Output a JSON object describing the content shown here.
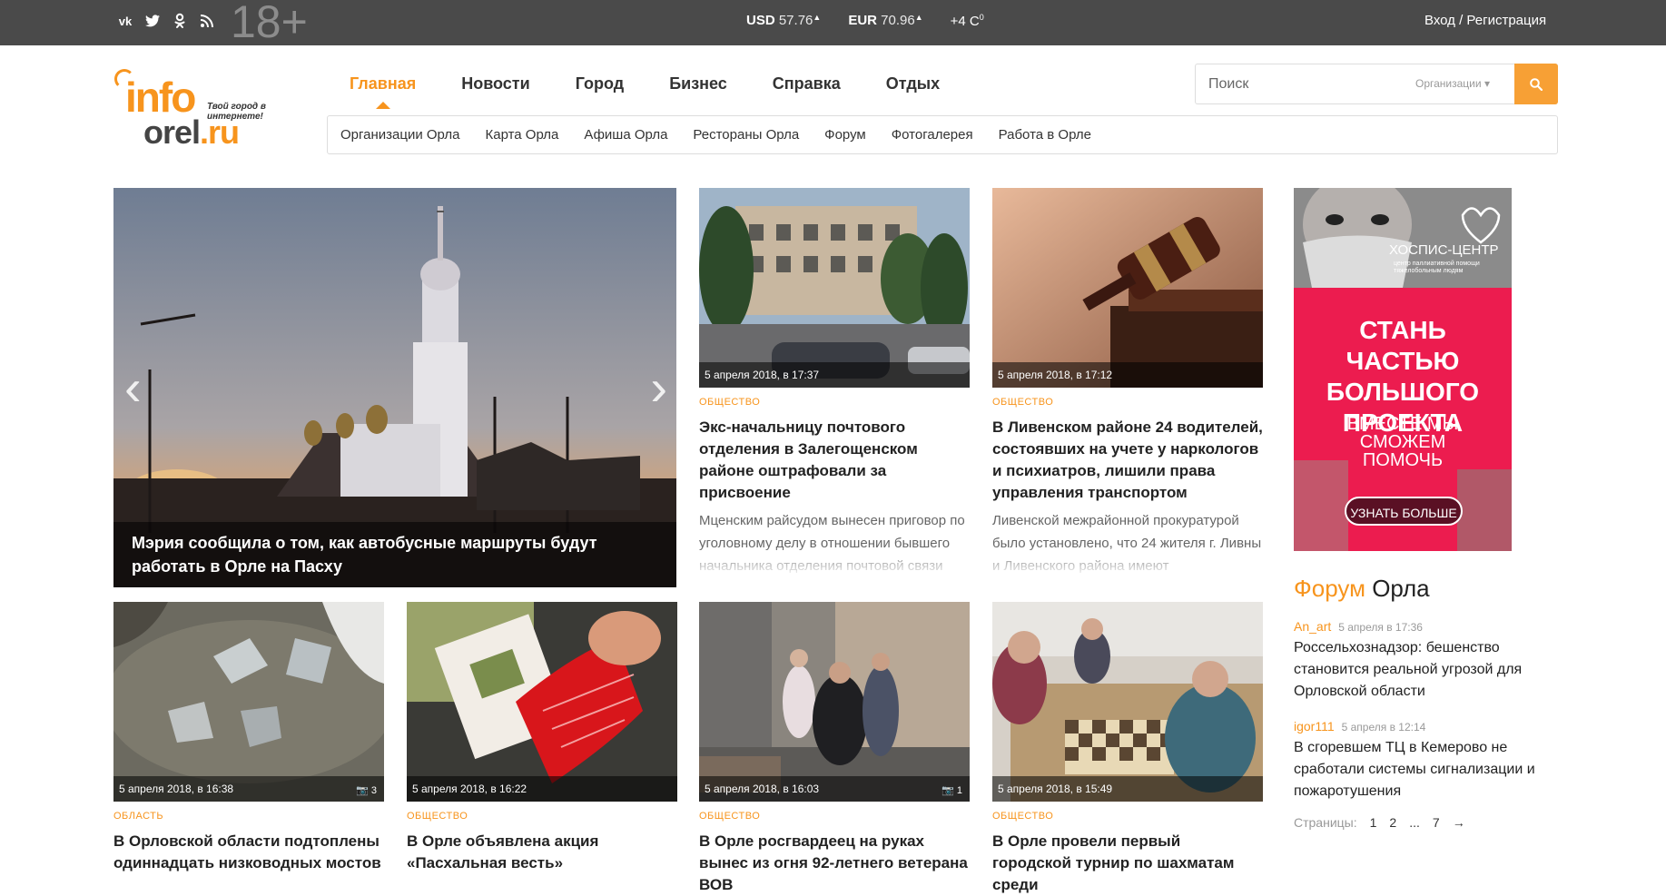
{
  "topbar": {
    "social": [
      "vk-icon",
      "twitter-icon",
      "odnoklassniki-icon",
      "rss-icon"
    ],
    "age": "18+",
    "usd_label": "USD",
    "usd_value": "57.76",
    "eur_label": "EUR",
    "eur_value": "70.96",
    "temp": "+4 С",
    "temp_sup": "0",
    "login": "Вход / Регистрация"
  },
  "logo": {
    "word1": "info",
    "word2": "orel",
    "word3": ".ru",
    "tagline": "Твой город в интернете!"
  },
  "nav": [
    "Главная",
    "Новости",
    "Город",
    "Бизнес",
    "Справка",
    "Отдых"
  ],
  "search": {
    "placeholder": "Поиск",
    "select": "Организации"
  },
  "subnav": [
    "Организации Орла",
    "Карта Орла",
    "Афиша Орла",
    "Рестораны Орла",
    "Форум",
    "Фотогалерея",
    "Работа в Орле"
  ],
  "hero": {
    "caption": "Мэрия сообщила о том, как автобусные маршруты будут работать в Орле на Пасху"
  },
  "cards": [
    {
      "date": "5 апреля 2018, в 17:37",
      "rubric": "общество",
      "title": "Экс-начальницу почтового отделения в Залегощенском районе оштрафовали за присвоение",
      "text": "Мценским райсудом вынесен приговор по уголовному делу в отношении бывшего начальника отделения почтовой связи Залегощенского района"
    },
    {
      "date": "5 апреля 2018, в 17:12",
      "rubric": "общество",
      "title": "В Ливенском районе 24 водителей, состоявших на учете у наркологов и психиатров, лишили права управления транспортом",
      "text": "Ливенской межрайонной прокуратурой было установлено, что 24 жителя г. Ливны и Ливенского района имеют"
    },
    {
      "date": "5 апреля 2018, в 16:38",
      "rubric": "область",
      "title": "В Орловской области подтоплены одиннадцать низководных мостов",
      "photos": "3"
    },
    {
      "date": "5 апреля 2018, в 16:22",
      "rubric": "общество",
      "title": "В Орле объявлена акция «Пасхальная весть»"
    },
    {
      "date": "5 апреля 2018, в 16:03",
      "rubric": "общество",
      "title": "В Орле росгвардеец на руках вынес из огня 92-летнего ветерана ВОВ",
      "photos": "1"
    },
    {
      "date": "5 апреля 2018, в 15:49",
      "rubric": "общество",
      "title": "В Орле провели первый городской турнир по шахматам среди"
    }
  ],
  "ad": {
    "brand": "ХОСПИС-ЦЕНТР",
    "brand_sub": "центр паллиативной помощи тяжелобольным людям",
    "headline": "СТАНЬ ЧАСТЬЮ БОЛЬШОГО ПРОЕКТА",
    "sub": "ВМЕСТЕ МЫ СМОЖЕМ ПОМОЧЬ",
    "button": "УЗНАТЬ БОЛЬШЕ"
  },
  "forum": {
    "title_a": "Форум",
    "title_b": " Орла",
    "posts": [
      {
        "user": "An_art",
        "time": "5 апреля в 17:36",
        "text": "Россельхознадзор: бешенство становится реальной угрозой для Орловской области"
      },
      {
        "user": "igor111",
        "time": "5 апреля в 12:14",
        "text": "В сгоревшем ТЦ в Кемерово не сработали системы сигнализации и пожаротушения"
      }
    ],
    "pages_label": "Страницы:",
    "pages": [
      "1",
      "2",
      "...",
      "7"
    ],
    "next": "→"
  },
  "colors": {
    "accent": "#f7941d",
    "topbar": "#4a4a4a",
    "ad": "#ec1c4f"
  }
}
